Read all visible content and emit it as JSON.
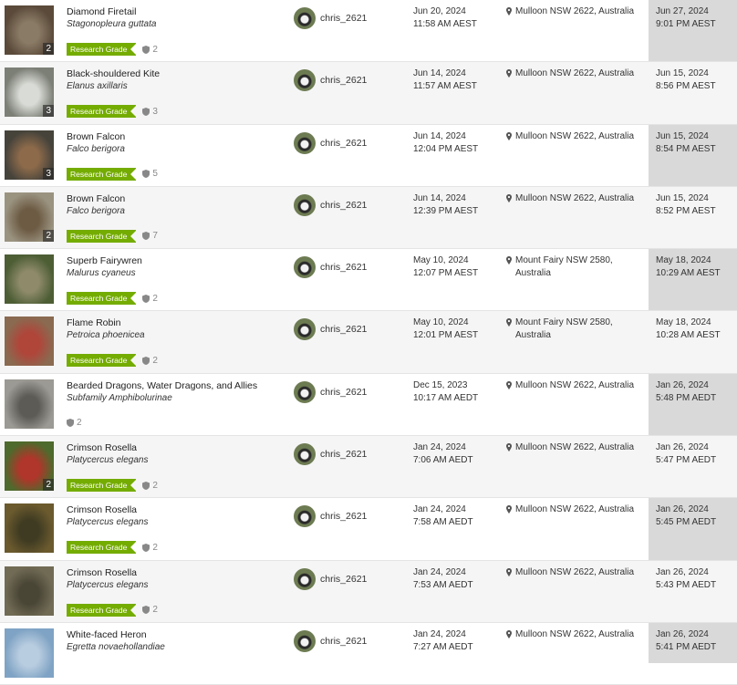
{
  "colors": {
    "research_grade": "#74ac00",
    "added_column_bg": "#d9d9d9"
  },
  "observations": [
    {
      "photo_count": "2",
      "common_name": "Diamond Firetail",
      "scientific_name": "Stagonopleura guttata",
      "quality_grade": "Research Grade",
      "identifications": "2",
      "user": "chris_2621",
      "observed_date": "Jun 20, 2024",
      "observed_time": "11:58 AM AEST",
      "place": "Mulloon NSW 2622, Australia",
      "added_date": "Jun 27, 2024",
      "added_time": "9:01 PM AEST",
      "thumb_colors": [
        "#5b4a3a",
        "#8a7b66"
      ]
    },
    {
      "photo_count": "3",
      "common_name": "Black-shouldered Kite",
      "scientific_name": "Elanus axillaris",
      "quality_grade": "Research Grade",
      "identifications": "3",
      "user": "chris_2621",
      "observed_date": "Jun 14, 2024",
      "observed_time": "11:57 AM AEST",
      "place": "Mulloon NSW 2622, Australia",
      "added_date": "Jun 15, 2024",
      "added_time": "8:56 PM AEST",
      "thumb_colors": [
        "#7c7f76",
        "#d9dbd6"
      ]
    },
    {
      "photo_count": "3",
      "common_name": "Brown Falcon",
      "scientific_name": "Falco berigora",
      "quality_grade": "Research Grade",
      "identifications": "5",
      "user": "chris_2621",
      "observed_date": "Jun 14, 2024",
      "observed_time": "12:04 PM AEST",
      "place": "Mulloon NSW 2622, Australia",
      "added_date": "Jun 15, 2024",
      "added_time": "8:54 PM AEST",
      "thumb_colors": [
        "#46433b",
        "#8c6a4a"
      ]
    },
    {
      "photo_count": "2",
      "common_name": "Brown Falcon",
      "scientific_name": "Falco berigora",
      "quality_grade": "Research Grade",
      "identifications": "7",
      "user": "chris_2621",
      "observed_date": "Jun 14, 2024",
      "observed_time": "12:39 PM AEST",
      "place": "Mulloon NSW 2622, Australia",
      "added_date": "Jun 15, 2024",
      "added_time": "8:52 PM AEST",
      "thumb_colors": [
        "#9a9380",
        "#6d5b44"
      ]
    },
    {
      "photo_count": "",
      "common_name": "Superb Fairywren",
      "scientific_name": "Malurus cyaneus",
      "quality_grade": "Research Grade",
      "identifications": "2",
      "user": "chris_2621",
      "observed_date": "May 10, 2024",
      "observed_time": "12:07 PM AEST",
      "place": "Mount Fairy NSW 2580, Australia",
      "added_date": "May 18, 2024",
      "added_time": "10:29 AM AEST",
      "thumb_colors": [
        "#4d5e35",
        "#8e8a6a"
      ]
    },
    {
      "photo_count": "",
      "common_name": "Flame Robin",
      "scientific_name": "Petroica phoenicea",
      "quality_grade": "Research Grade",
      "identifications": "2",
      "user": "chris_2621",
      "observed_date": "May 10, 2024",
      "observed_time": "12:01 PM AEST",
      "place": "Mount Fairy NSW 2580, Australia",
      "added_date": "May 18, 2024",
      "added_time": "10:28 AM AEST",
      "thumb_colors": [
        "#8a6a50",
        "#b0453a"
      ]
    },
    {
      "photo_count": "",
      "common_name": "Bearded Dragons, Water Dragons, and Allies",
      "scientific_name": "Subfamily Amphibolurinae",
      "quality_grade": "",
      "identifications": "2",
      "user": "chris_2621",
      "observed_date": "Dec 15, 2023",
      "observed_time": "10:17 AM AEDT",
      "place": "Mulloon NSW 2622, Australia",
      "added_date": "Jan 26, 2024",
      "added_time": "5:48 PM AEDT",
      "thumb_colors": [
        "#9c9a94",
        "#5d5b55"
      ]
    },
    {
      "photo_count": "2",
      "common_name": "Crimson Rosella",
      "scientific_name": "Platycercus elegans",
      "quality_grade": "Research Grade",
      "identifications": "2",
      "user": "chris_2621",
      "observed_date": "Jan 24, 2024",
      "observed_time": "7:06 AM AEDT",
      "place": "Mulloon NSW 2622, Australia",
      "added_date": "Jan 26, 2024",
      "added_time": "5:47 PM AEDT",
      "thumb_colors": [
        "#4e6a2c",
        "#b0352a"
      ]
    },
    {
      "photo_count": "",
      "common_name": "Crimson Rosella",
      "scientific_name": "Platycercus elegans",
      "quality_grade": "Research Grade",
      "identifications": "2",
      "user": "chris_2621",
      "observed_date": "Jan 24, 2024",
      "observed_time": "7:58 AM AEDT",
      "place": "Mulloon NSW 2622, Australia",
      "added_date": "Jan 26, 2024",
      "added_time": "5:45 PM AEDT",
      "thumb_colors": [
        "#6b5a2e",
        "#3f3b22"
      ]
    },
    {
      "photo_count": "",
      "common_name": "Crimson Rosella",
      "scientific_name": "Platycercus elegans",
      "quality_grade": "Research Grade",
      "identifications": "2",
      "user": "chris_2621",
      "observed_date": "Jan 24, 2024",
      "observed_time": "7:53 AM AEDT",
      "place": "Mulloon NSW 2622, Australia",
      "added_date": "Jan 26, 2024",
      "added_time": "5:43 PM AEDT",
      "thumb_colors": [
        "#716b55",
        "#4a4636"
      ]
    },
    {
      "photo_count": "",
      "common_name": "White-faced Heron",
      "scientific_name": "Egretta novaehollandiae",
      "quality_grade": "",
      "identifications": "",
      "user": "chris_2621",
      "observed_date": "Jan 24, 2024",
      "observed_time": "7:27 AM AEDT",
      "place": "Mulloon NSW 2622, Australia",
      "added_date": "Jan 26, 2024",
      "added_time": "5:41 PM AEDT",
      "thumb_colors": [
        "#7fa3c4",
        "#b9cde0"
      ]
    }
  ]
}
